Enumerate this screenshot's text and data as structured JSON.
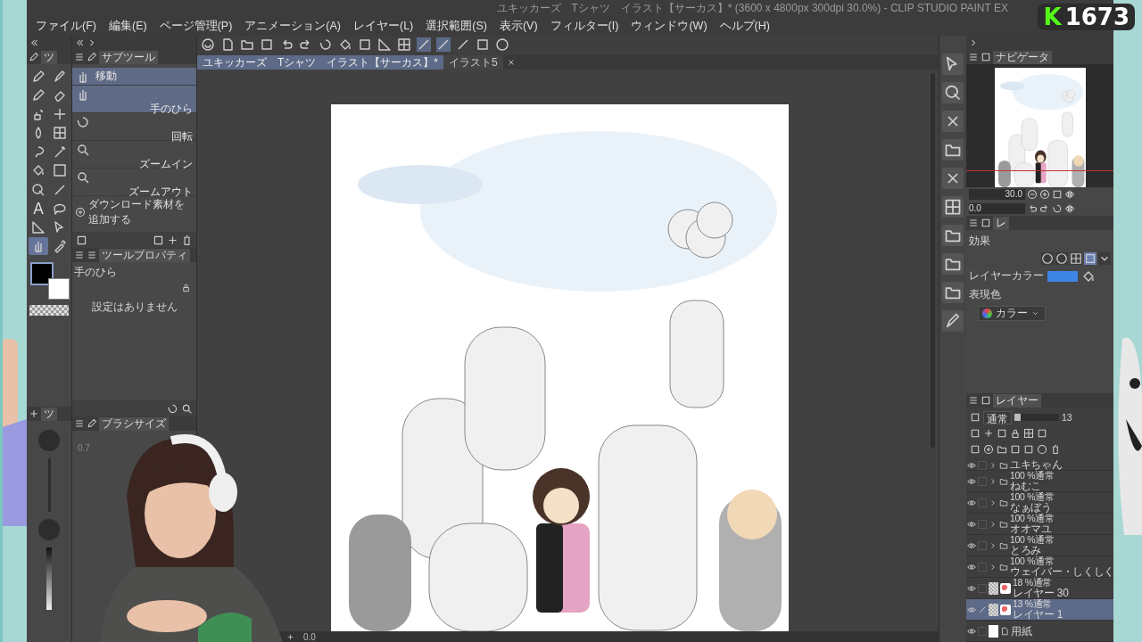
{
  "window": {
    "title": "ユキッカーズ　Tシャツ　イラスト【サーカス】* (3600 x 4800px 300dpi 30.0%) - CLIP STUDIO PAINT EX"
  },
  "menu": [
    "ファイル(F)",
    "編集(E)",
    "ページ管理(P)",
    "アニメーション(A)",
    "レイヤー(L)",
    "選択範囲(S)",
    "表示(V)",
    "フィルター(I)",
    "ウィンドウ(W)",
    "ヘルプ(H)"
  ],
  "document_tabs": [
    {
      "label": "ユキッカーズ　Tシャツ　イラスト【サーカス】*",
      "selected": true
    },
    {
      "label": "イラスト5",
      "selected": false
    }
  ],
  "tool_palette": {
    "tab": "ツ",
    "tools": [
      {
        "selected": false
      },
      {
        "selected": false
      },
      {
        "selected": false
      },
      {
        "selected": false
      },
      {
        "selected": false
      },
      {
        "selected": false
      },
      {
        "selected": false
      },
      {
        "selected": false
      },
      {
        "selected": false
      },
      {
        "selected": false
      },
      {
        "selected": false
      },
      {
        "selected": false
      },
      {
        "selected": false
      },
      {
        "selected": false
      },
      {
        "selected": false,
        "label": "A"
      },
      {
        "selected": false
      },
      {
        "selected": false
      },
      {
        "selected": false
      },
      {
        "selected": true
      },
      {
        "selected": false
      }
    ]
  },
  "subtool": {
    "tab": "サブツール",
    "items": [
      {
        "label": "移動",
        "kind": "move",
        "selected": true
      },
      {
        "label": "手のひら",
        "kind": "hand",
        "selected": true
      },
      {
        "label": "回転",
        "kind": "rotate",
        "selected": false
      },
      {
        "label": "ズームイン",
        "kind": "zoom",
        "selected": false
      },
      {
        "label": "ズームアウト",
        "kind": "zoom",
        "selected": false
      }
    ],
    "add_button": "ダウンロード素材を追加する"
  },
  "tool_property": {
    "tab": "ツールプロパティ",
    "tool": "手のひら",
    "message": "設定はありません"
  },
  "color_palette": {
    "tab": "ツ"
  },
  "brush_size": {
    "tab": "ブラシサイズ",
    "sizes": [
      "0.7"
    ]
  },
  "navigator": {
    "tab": "ナビゲータ",
    "zoom": "30.0",
    "rotation": "0.0"
  },
  "layer_property": {
    "tab": "レ",
    "effect_label": "効果",
    "layer_color_label": "レイヤーカラー",
    "expression_label": "表現色",
    "expression_value": "カラー"
  },
  "layers": {
    "tab": "レイヤー",
    "blend": "通常",
    "opacity": "13",
    "opacity_slider": {
      "level": 0.13
    },
    "rows": [
      {
        "kind": "folder",
        "name": "ユキちゃん",
        "selected": false
      },
      {
        "kind": "folder",
        "mode": "100 %通常",
        "name": "ねむこ",
        "selected": false
      },
      {
        "kind": "folder",
        "mode": "100 %通常",
        "name": "なぁぼう",
        "selected": false
      },
      {
        "kind": "folder",
        "mode": "100 %通常",
        "name": "オオマユ",
        "selected": false
      },
      {
        "kind": "folder",
        "mode": "100 %通常",
        "name": "とろみ",
        "selected": false
      },
      {
        "kind": "folder",
        "mode": "100 %通常",
        "name": "ウェイバー・しくしく",
        "selected": false
      },
      {
        "kind": "raster",
        "mode": "18 %通常",
        "name": "レイヤー 30",
        "selected": false
      },
      {
        "kind": "raster",
        "mode": "13 %通常",
        "name": "レイヤー 1",
        "selected": true
      },
      {
        "kind": "paper",
        "name": "用紙",
        "selected": false
      }
    ]
  },
  "status_bar": {
    "zoom": "0.0"
  },
  "stream_overlay": {
    "logo": "K",
    "count": "1673"
  }
}
